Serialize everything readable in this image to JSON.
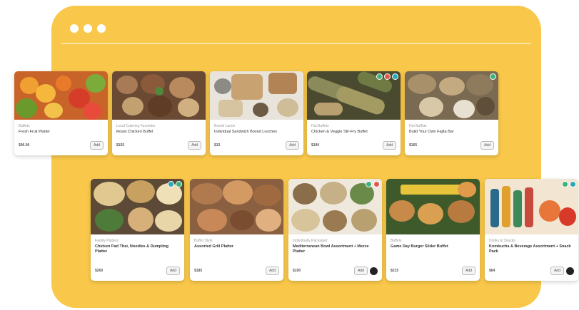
{
  "colors": {
    "frame": "#f9c84a",
    "badge_green": "#3bb37a",
    "badge_red": "#e2574c",
    "badge_teal": "#2aa8b8"
  },
  "frame": {
    "dots": 3
  },
  "rows": [
    {
      "cards": [
        {
          "category": "Buffets",
          "title": "Fresh Fruit Platter",
          "price": "$96.00",
          "button": "Add"
        },
        {
          "category": "Local Catering Favorites",
          "title": "Roast Chicken Buffet",
          "price": "$155",
          "button": "Add"
        },
        {
          "category": "Boxed Lunch",
          "title": "Individual Sandwich Boxed Lunches",
          "price": "$13",
          "button": "Add"
        },
        {
          "category": "Hot Buffets",
          "title": "Chicken & Veggie Stir-Fry Buffet",
          "price": "$190",
          "button": "Add"
        },
        {
          "category": "Hot Buffets",
          "title": "Build Your Own Fajita Bar",
          "price": "$165",
          "button": "Add"
        }
      ]
    },
    {
      "cards": [
        {
          "category": "Family Platters",
          "title": "Chicken Pad Thai, Noodles & Dumpling Platter",
          "price": "$260",
          "button": "Add"
        },
        {
          "category": "Buffet Style",
          "title": "Assorted Grill Platter",
          "price": "$185",
          "button": "Add"
        },
        {
          "category": "Individually Packaged",
          "title": "Mediterranean Bowl Assortment + Mezze Platter",
          "price": "$190",
          "button": "Add"
        },
        {
          "category": "Buffets",
          "title": "Game Day Burger Slider Buffet",
          "price": "$215",
          "button": "Add"
        },
        {
          "category": "Drinks & Snacks",
          "title": "Kombucha & Beverage Assortment + Snack Pack",
          "price": "$64",
          "button": "Add"
        }
      ]
    }
  ]
}
